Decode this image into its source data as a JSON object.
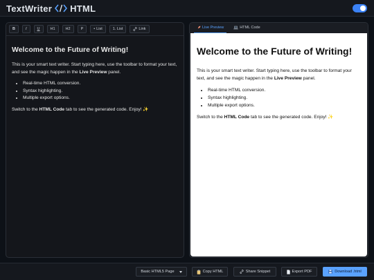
{
  "header": {
    "brand_left": "TextWriter",
    "brand_code": "</>",
    "brand_right": "HTML"
  },
  "toolbar": {
    "bold": "B",
    "italic": "I",
    "underline": "U",
    "h1": "H1",
    "h2": "H2",
    "p": "P",
    "bullet_list": "List",
    "numbered_list": "1. List",
    "link": "Link"
  },
  "document": {
    "title": "Welcome to the Future of Writing!",
    "intro_before": "This is your smart text writer. Start typing here, use the toolbar to format your text, and see the magic happen in the ",
    "intro_strong": "Live Preview",
    "intro_after": " panel.",
    "list": [
      "Real-time HTML conversion.",
      "Syntax highlighting.",
      "Multiple export options."
    ],
    "outro_before": "Switch to the ",
    "outro_strong": "HTML Code",
    "outro_after": " tab to see the generated code. Enjoy! ✨"
  },
  "tabs": {
    "live_preview": "Live Preview",
    "html_code": "HTML Code"
  },
  "footer": {
    "template_select": "Basic HTML5 Page",
    "copy_html": "Copy HTML",
    "share_snippet": "Share Snippet",
    "export_pdf": "Export PDF",
    "download": "Download .html"
  },
  "colors": {
    "accent": "#5aa2ff",
    "toggle": "#3b82f6",
    "background": "#0d1117"
  }
}
